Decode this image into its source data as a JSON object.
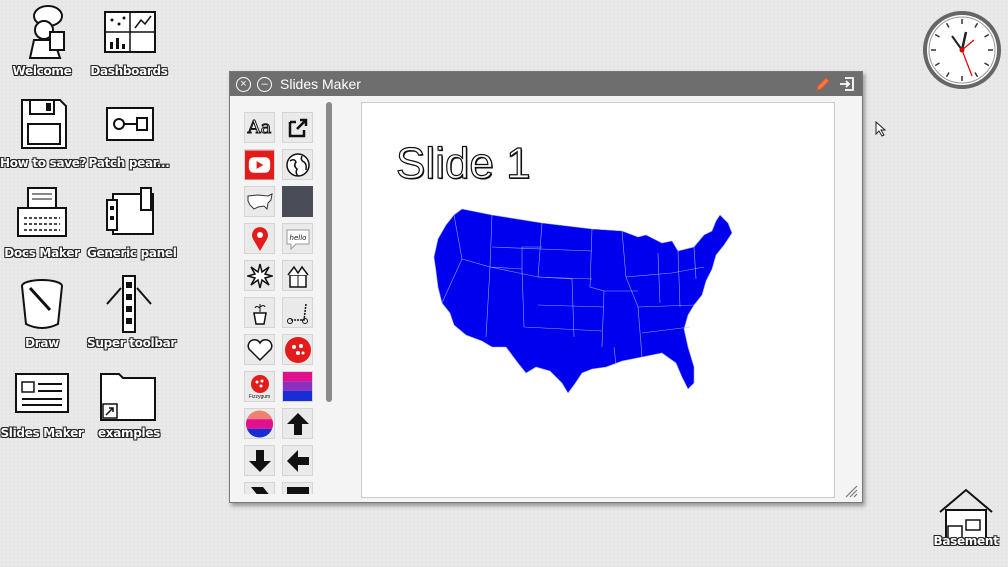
{
  "desktop": {
    "icons": [
      {
        "label": "Welcome"
      },
      {
        "label": "Dashboards"
      },
      {
        "label": "How to save?"
      },
      {
        "label": "Patch pear..."
      },
      {
        "label": "Docs Maker"
      },
      {
        "label": "Generic panel"
      },
      {
        "label": "Draw"
      },
      {
        "label": "Super toolbar"
      },
      {
        "label": "Slides Maker"
      },
      {
        "label": "examples"
      },
      {
        "label": "Basement"
      }
    ]
  },
  "window": {
    "title": "Slides Maker",
    "close_icon": "close-icon",
    "minimize_icon": "minimize-icon",
    "edit_icon": "pencil-icon",
    "exit_icon": "exit-icon",
    "accent": "#6e6e6e"
  },
  "palette": {
    "items": [
      {
        "icon": "text-icon",
        "text": "Aa"
      },
      {
        "icon": "external-link-icon"
      },
      {
        "icon": "youtube-icon"
      },
      {
        "icon": "globe-icon"
      },
      {
        "icon": "usa-outline-icon"
      },
      {
        "icon": "dark-square-icon"
      },
      {
        "icon": "map-pin-icon"
      },
      {
        "icon": "hello-bubble-icon",
        "text": "hello"
      },
      {
        "icon": "burst-icon"
      },
      {
        "icon": "gift-box-icon"
      },
      {
        "icon": "plant-pot-icon"
      },
      {
        "icon": "scooter-icon"
      },
      {
        "icon": "heart-icon"
      },
      {
        "icon": "pizza-icon"
      },
      {
        "icon": "fizzygum-logo-icon",
        "text": "Fizzygum"
      },
      {
        "icon": "stripes-flag-icon"
      },
      {
        "icon": "stripes-circle-icon"
      },
      {
        "icon": "arrow-up-icon"
      },
      {
        "icon": "arrow-down-icon"
      },
      {
        "icon": "arrow-left-icon"
      }
    ]
  },
  "slide": {
    "title": "Slide 1",
    "map_icon": "usa-map-icon",
    "map_color": "#0000ee"
  }
}
